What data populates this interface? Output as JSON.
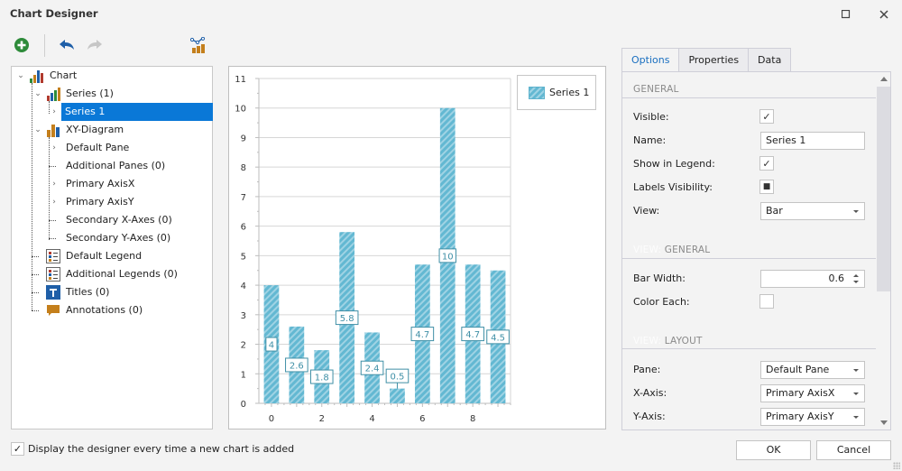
{
  "window": {
    "title": "Chart Designer",
    "maximize_icon": "maximize-icon",
    "close_icon": "close-icon"
  },
  "toolbar": {
    "items": [
      {
        "name": "add",
        "icon": "add-circle-icon",
        "color": "#2e8b3a"
      },
      {
        "name": "undo",
        "icon": "undo-icon",
        "color": "#1f5fa8"
      },
      {
        "name": "redo",
        "icon": "redo-icon",
        "color": "#c0c0c0",
        "disabled": true
      },
      {
        "name": "change-chart-type",
        "icon": "chart-type-icon",
        "color": "#c47f1c"
      }
    ]
  },
  "tree": {
    "items": [
      {
        "label": "Chart",
        "icon": "chart-icon",
        "expanded": true,
        "level": 0
      },
      {
        "label": "Series (1)",
        "icon": "series-icon",
        "expanded": true,
        "level": 1
      },
      {
        "label": "Series 1",
        "icon": null,
        "collapsed": true,
        "level": 2,
        "selected": true
      },
      {
        "label": "XY-Diagram",
        "icon": "diagram-icon",
        "expanded": true,
        "level": 1
      },
      {
        "label": "Default Pane",
        "collapsed": true,
        "level": 2
      },
      {
        "label": "Additional Panes (0)",
        "level": 2
      },
      {
        "label": "Primary AxisX",
        "collapsed": true,
        "level": 2
      },
      {
        "label": "Primary AxisY",
        "collapsed": true,
        "level": 2
      },
      {
        "label": "Secondary X-Axes (0)",
        "level": 2
      },
      {
        "label": "Secondary Y-Axes (0)",
        "level": 2
      },
      {
        "label": "Default Legend",
        "icon": "legend-icon",
        "level": 1
      },
      {
        "label": "Additional Legends (0)",
        "icon": "legend-icon",
        "level": 1
      },
      {
        "label": "Titles (0)",
        "icon": "title-icon",
        "level": 1
      },
      {
        "label": "Annotations (0)",
        "icon": "annotation-icon",
        "level": 1
      }
    ]
  },
  "chart_data": {
    "type": "bar",
    "title": "",
    "xlabel": "",
    "ylabel": "",
    "x": [
      0,
      1,
      2,
      3,
      4,
      5,
      6,
      7,
      8,
      9
    ],
    "series": [
      {
        "name": "Series 1",
        "values": [
          4,
          2.6,
          1.8,
          5.8,
          2.4,
          0.5,
          4.7,
          10,
          4.7,
          4.5
        ],
        "color": "#63b8d2",
        "hatch_color": "#9fd3e4"
      }
    ],
    "data_labels": [
      "4",
      "2.6",
      "1.8",
      "5.8",
      "2.4",
      "0.5",
      "4.7",
      "10",
      "4.7",
      "4.5"
    ],
    "ylim": [
      0,
      11
    ],
    "xlim": [
      -0.5,
      9.5
    ],
    "y_ticks": [
      0,
      1,
      2,
      3,
      4,
      5,
      6,
      7,
      8,
      9,
      10,
      11
    ],
    "x_ticks": [
      0,
      2,
      4,
      6,
      8
    ],
    "grid": true,
    "legend_position": "top-right",
    "bar_width": 0.6
  },
  "legend": {
    "label": "Series 1"
  },
  "tabs": [
    {
      "label": "Options",
      "active": true
    },
    {
      "label": "Properties",
      "active": false
    },
    {
      "label": "Data",
      "active": false
    }
  ],
  "options": {
    "general": {
      "header": "GENERAL",
      "visible_label": "Visible:",
      "visible": true,
      "name_label": "Name:",
      "name_value": "Series 1",
      "show_in_legend_label": "Show in Legend:",
      "show_in_legend": true,
      "labels_visibility_label": "Labels Visibility:",
      "labels_visibility": "indeterminate",
      "view_label": "View:",
      "view_value": "Bar"
    },
    "view_general": {
      "header_prefix": "VIEW:",
      "header": "GENERAL",
      "bar_width_label": "Bar Width:",
      "bar_width_value": "0.6",
      "color_each_label": "Color Each:",
      "color_each": false
    },
    "view_layout": {
      "header_prefix": "VIEW:",
      "header": "LAYOUT",
      "pane_label": "Pane:",
      "pane_value": "Default Pane",
      "x_axis_label": "X-Axis:",
      "x_axis_value": "Primary AxisX",
      "y_axis_label": "Y-Axis:",
      "y_axis_value": "Primary AxisY"
    }
  },
  "footer": {
    "display_designer_label": "Display the designer every time a new chart is added",
    "display_designer_checked": true,
    "ok_label": "OK",
    "cancel_label": "Cancel"
  },
  "glyphs": {
    "check": "✓",
    "square": "■"
  }
}
